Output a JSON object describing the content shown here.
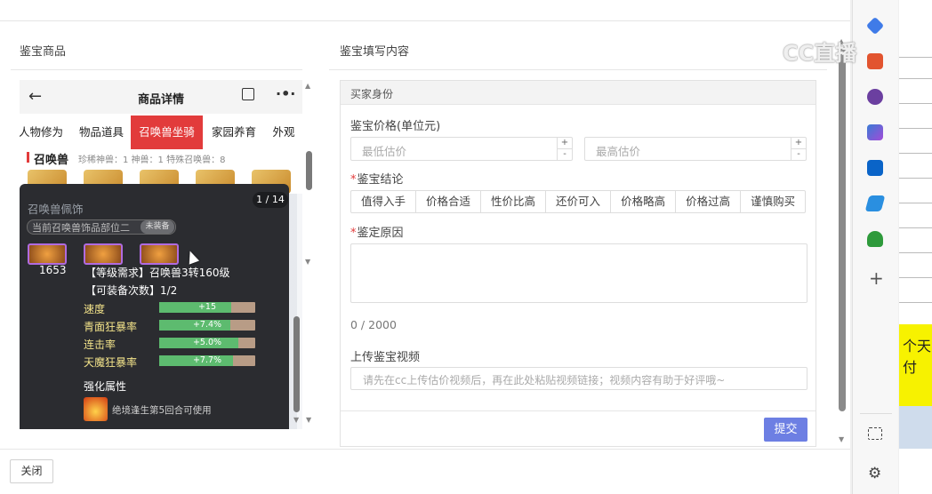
{
  "left_panel": {
    "title": "鉴宝商品"
  },
  "right_panel": {
    "title": "鉴宝填写内容"
  },
  "phone": {
    "back_icon": "arrow-left-icon",
    "title": "商品详情",
    "tabs": [
      {
        "label": "人物修为"
      },
      {
        "label": "物品道具"
      },
      {
        "label": "召唤兽坐骑",
        "active": true
      },
      {
        "label": "家园养育"
      },
      {
        "label": "外观"
      }
    ],
    "section_title": "召唤兽",
    "section_meta": "珍稀神兽：1   神兽：1   特殊召唤兽：8"
  },
  "tooltip": {
    "title": "召唤兽佩饰",
    "count": "1 / 14",
    "slot_label": "当前召唤兽饰品部位二",
    "slot_badge": "未装备",
    "price": "1653",
    "requirement": "【等级需求】召唤兽3转160级",
    "equip_count": "【可装备次数】1/2",
    "stats": [
      {
        "label": "速度",
        "value": "+15",
        "fill": 0.75
      },
      {
        "label": "青面狂暴率",
        "value": "+7.4%",
        "fill": 0.74
      },
      {
        "label": "连击率",
        "value": "+5.0%",
        "fill": 0.82
      },
      {
        "label": "天魔狂暴率",
        "value": "+7.7%",
        "fill": 0.77
      }
    ],
    "enhance_title": "强化属性",
    "enhance_text": "绝境逢生第5回合可使用"
  },
  "form": {
    "section_header": "买家身份",
    "price_label": "鉴宝价格(单位元)",
    "min_placeholder": "最低估价",
    "max_placeholder": "最高估价",
    "spin_up": "+",
    "spin_down": "-",
    "conclusion_label": "鉴宝结论",
    "conclusions": [
      "值得入手",
      "价格合适",
      "性价比高",
      "还价可入",
      "价格略高",
      "价格过高",
      "谨慎购买"
    ],
    "reason_label": "鉴定原因",
    "counter": "0 / 2000",
    "video_label": "上传鉴宝视频",
    "video_placeholder": "请先在cc上传估价视频后，再在此处粘贴视频链接；视频内容有助于好评哦~",
    "submit_label": "提交"
  },
  "footer": {
    "close_label": "关闭"
  },
  "watermark": "CC直播",
  "background_page": {
    "text": "个天付"
  },
  "colors": {
    "accent": "#6d7fe3",
    "tab_active": "#e23b3b",
    "stat_fill": "#5dbb6f"
  }
}
